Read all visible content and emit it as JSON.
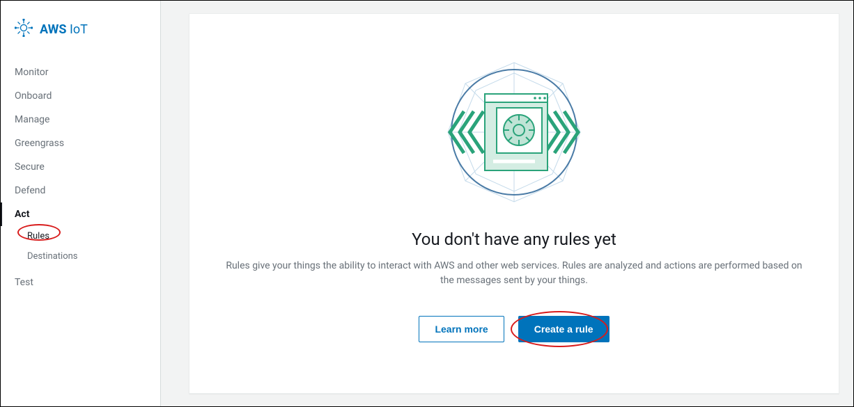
{
  "brand": {
    "name_bold": "AWS",
    "name_light": "IoT"
  },
  "sidebar": {
    "items": [
      {
        "label": "Monitor",
        "active": false
      },
      {
        "label": "Onboard",
        "active": false
      },
      {
        "label": "Manage",
        "active": false
      },
      {
        "label": "Greengrass",
        "active": false
      },
      {
        "label": "Secure",
        "active": false
      },
      {
        "label": "Defend",
        "active": false
      },
      {
        "label": "Act",
        "active": true
      },
      {
        "label": "Test",
        "active": false
      }
    ],
    "act_sub": [
      {
        "label": "Rules",
        "highlighted": true
      },
      {
        "label": "Destinations",
        "highlighted": false
      }
    ]
  },
  "main": {
    "empty_title": "You don't have any rules yet",
    "empty_desc": "Rules give your things the ability to interact with AWS and other web services. Rules are analyzed and actions are performed based on the messages sent by your things.",
    "learn_more_label": "Learn more",
    "create_rule_label": "Create a rule"
  }
}
